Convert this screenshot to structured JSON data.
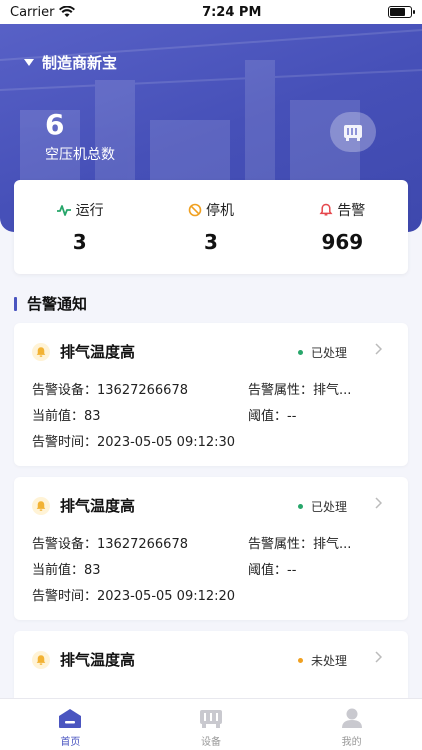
{
  "status_bar": {
    "carrier": "Carrier",
    "time": "7:24 PM"
  },
  "header": {
    "company": "制造商新宝",
    "total_count": "6",
    "total_label": "空压机总数"
  },
  "stats": [
    {
      "label": "运行",
      "value": "3",
      "icon": "pulse-icon",
      "color": "#27a66a"
    },
    {
      "label": "停机",
      "value": "3",
      "icon": "stop-icon",
      "color": "#f0a020"
    },
    {
      "label": "告警",
      "value": "969",
      "icon": "bell-icon",
      "color": "#e5484d"
    }
  ],
  "section": {
    "title": "告警通知"
  },
  "alarms": [
    {
      "title": "排气温度高",
      "status": "已处理",
      "status_color": "#27a66a",
      "device": "告警设备：13627266678",
      "attr": "告警属性：排气...",
      "current": "当前值：83",
      "threshold": "阈值：--",
      "time": "告警时间：2023-05-05 09:12:30"
    },
    {
      "title": "排气温度高",
      "status": "已处理",
      "status_color": "#27a66a",
      "device": "告警设备：13627266678",
      "attr": "告警属性：排气...",
      "current": "当前值：83",
      "threshold": "阈值：--",
      "time": "告警时间：2023-05-05 09:12:20"
    },
    {
      "title": "排气温度高",
      "status": "未处理",
      "status_color": "#f0a020",
      "device": "",
      "attr": "",
      "current": "",
      "threshold": "",
      "time": ""
    }
  ],
  "tabs": [
    {
      "label": "首页",
      "active": true,
      "icon": "home-icon"
    },
    {
      "label": "设备",
      "active": false,
      "icon": "device-icon"
    },
    {
      "label": "我的",
      "active": false,
      "icon": "user-icon"
    }
  ],
  "colors": {
    "primary": "#4a55c0"
  }
}
